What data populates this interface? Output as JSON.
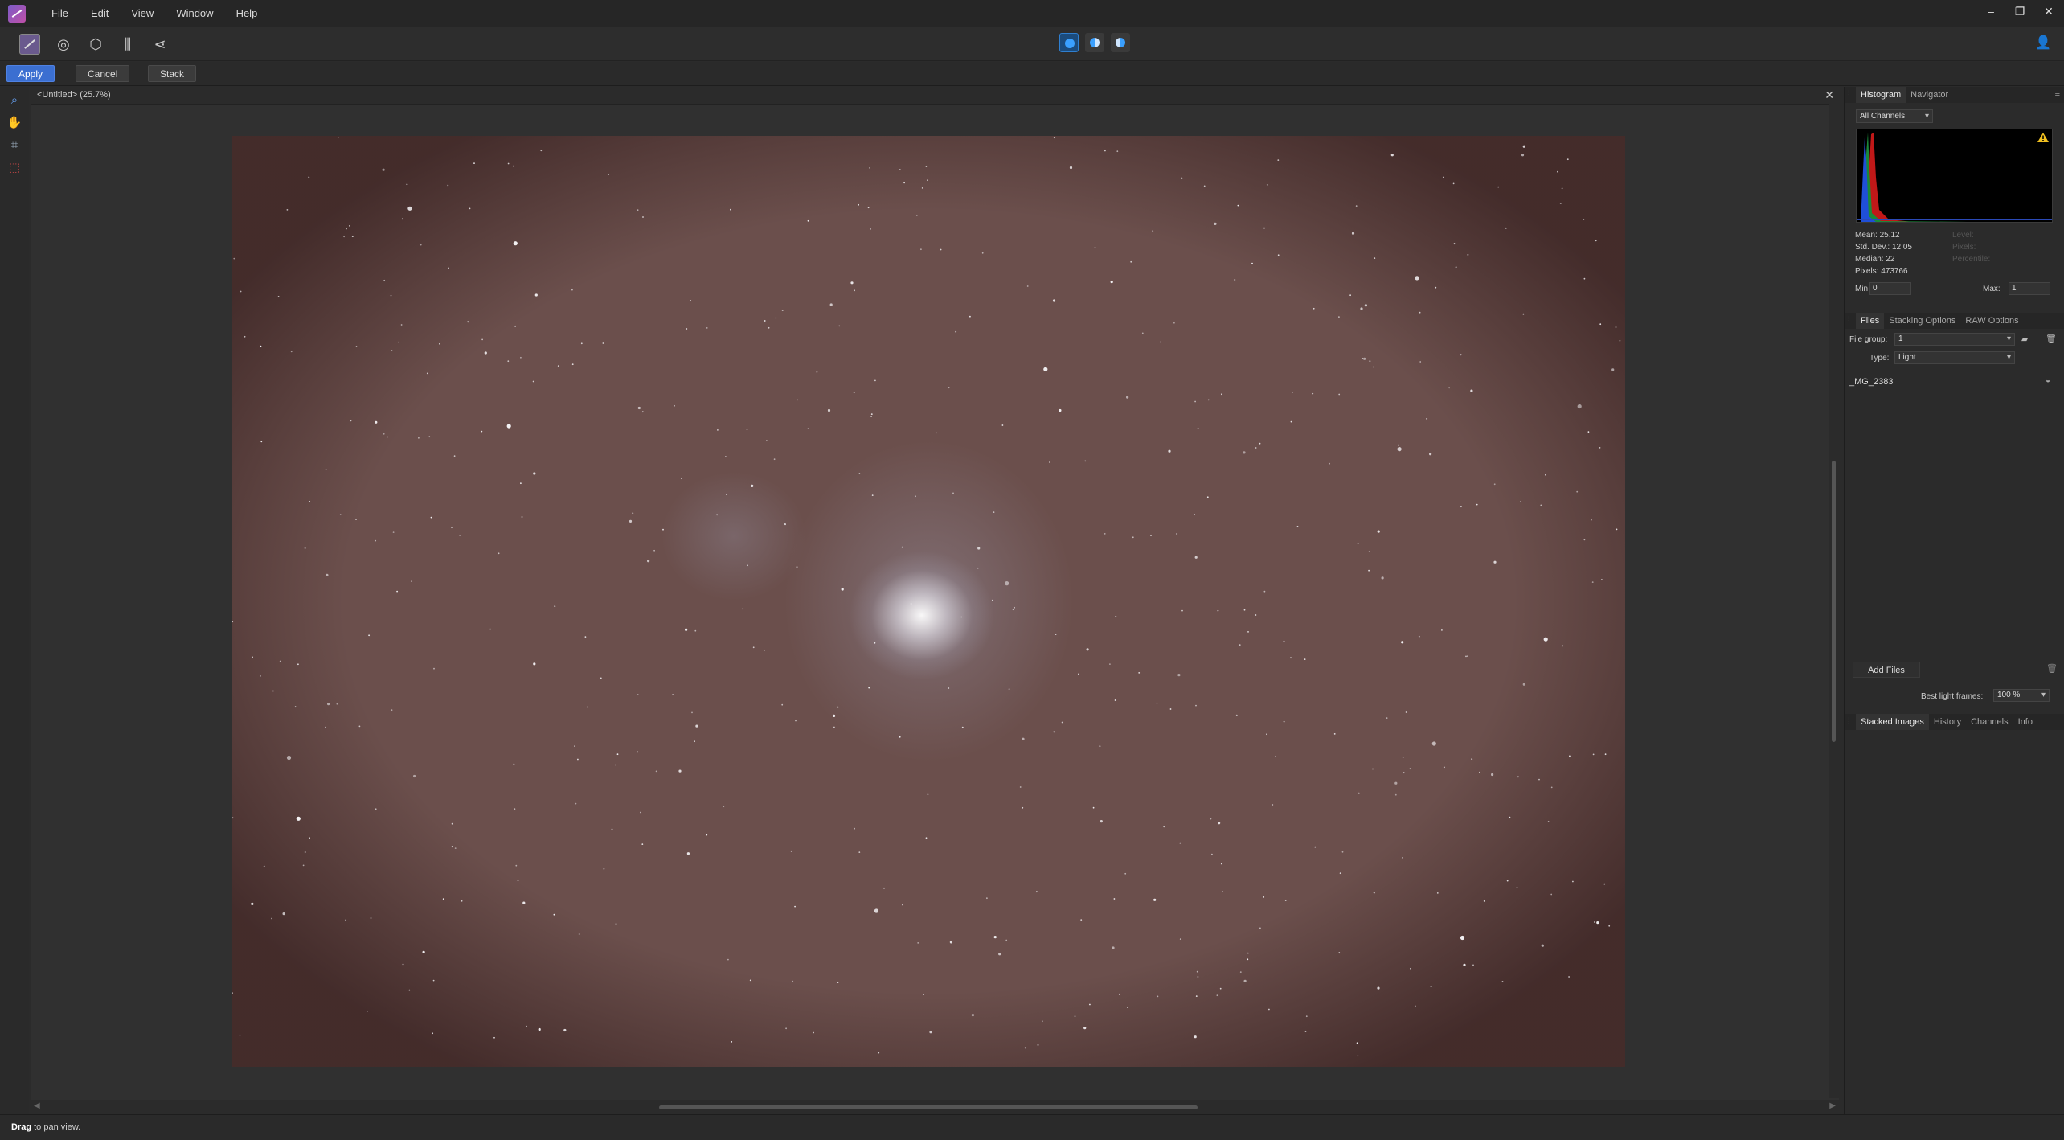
{
  "menubar": {
    "items": [
      "File",
      "Edit",
      "View",
      "Window",
      "Help"
    ],
    "window_controls": {
      "minimize": "–",
      "restore": "❐",
      "close": "✕"
    }
  },
  "toolbar": {
    "persona_icons": [
      "photo-persona-icon",
      "liquify-persona-icon",
      "develop-persona-icon",
      "tone-mapping-persona-icon",
      "export-persona-icon"
    ],
    "view_mode_icons": [
      "view-mode-icon-1",
      "split-view-icon",
      "mirror-view-icon"
    ],
    "user_icon": "user-icon"
  },
  "context": {
    "apply": "Apply",
    "cancel": "Cancel",
    "stack": "Stack",
    "accent_color": "#3b6fd1"
  },
  "tools": [
    "zoom-tool-icon",
    "hand-tool-icon",
    "crop-tool-icon",
    "selection-tool-icon"
  ],
  "document": {
    "title": "<Untitled> (25.7%)",
    "close": "✕",
    "canvas_color": "#6b4f4c"
  },
  "histogram": {
    "tabs": [
      "Histogram",
      "Navigator"
    ],
    "channel": "All Channels",
    "mean": "Mean: 25.12",
    "std_dev": "Std. Dev.: 12.05",
    "median": "Median: 22",
    "pixels": "Pixels: 473766",
    "dim_stats": [
      "Level:",
      "Pixels:",
      "Percentile:"
    ],
    "min_label": "Min:",
    "min_value": "0",
    "max_label": "Max:",
    "max_value": "1"
  },
  "files_panel": {
    "tabs": [
      "Files",
      "Stacking Options",
      "RAW Options"
    ],
    "file_group_label": "File group:",
    "file_group_value": "1",
    "type_label": "Type:",
    "type_value": "Light",
    "files": [
      "_MG_2383"
    ],
    "add_files": "Add Files",
    "best_frames_label": "Best light frames:",
    "best_frames_value": "100 %"
  },
  "bottom_panel": {
    "tabs": [
      "Stacked Images",
      "History",
      "Channels",
      "Info"
    ]
  },
  "status": {
    "bold": "Drag",
    "text": " to pan view."
  }
}
